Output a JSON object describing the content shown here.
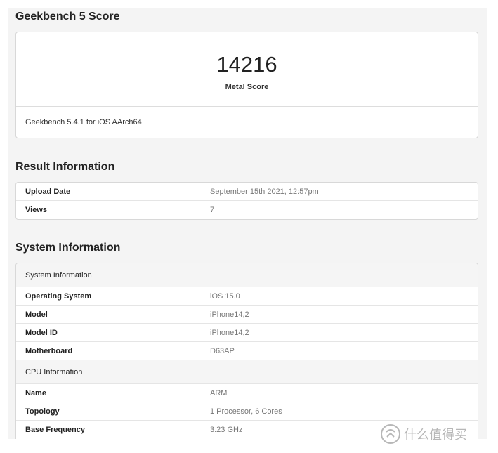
{
  "score": {
    "title": "Geekbench 5 Score",
    "value": "14216",
    "label": "Metal Score",
    "version": "Geekbench 5.4.1 for iOS AArch64"
  },
  "result": {
    "title": "Result Information",
    "rows": [
      {
        "key": "Upload Date",
        "value": "September 15th 2021, 12:57pm"
      },
      {
        "key": "Views",
        "value": "7"
      }
    ]
  },
  "system": {
    "title": "System Information",
    "groups": [
      {
        "heading": "System Information",
        "rows": [
          {
            "key": "Operating System",
            "value": "iOS 15.0"
          },
          {
            "key": "Model",
            "value": "iPhone14,2"
          },
          {
            "key": "Model ID",
            "value": "iPhone14,2"
          },
          {
            "key": "Motherboard",
            "value": "D63AP"
          }
        ]
      },
      {
        "heading": "CPU Information",
        "rows": [
          {
            "key": "Name",
            "value": "ARM"
          },
          {
            "key": "Topology",
            "value": "1 Processor, 6 Cores"
          },
          {
            "key": "Base Frequency",
            "value": "3.23 GHz"
          }
        ]
      }
    ]
  },
  "watermark": {
    "text": "什么值得买",
    "icon": "smzdm-logo-icon"
  },
  "colors": {
    "page_bg": "#f4f4f4",
    "card_bg": "#ffffff",
    "border": "#d8d8d8",
    "value_text": "#777777"
  }
}
